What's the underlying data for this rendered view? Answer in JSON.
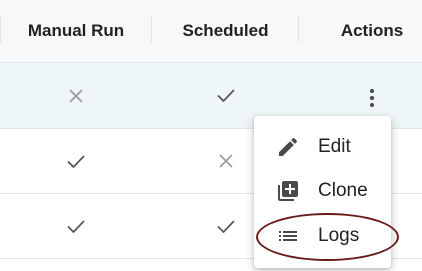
{
  "table": {
    "headers": [
      "Manual Run",
      "Scheduled",
      "Actions"
    ],
    "rows": [
      {
        "manual_run": "cross",
        "scheduled": "check",
        "highlighted": true
      },
      {
        "manual_run": "check",
        "scheduled": "cross",
        "highlighted": false
      },
      {
        "manual_run": "check",
        "scheduled": "check",
        "highlighted": false
      }
    ]
  },
  "actions_menu": {
    "items": [
      {
        "label": "Edit",
        "icon": "pencil-icon"
      },
      {
        "label": "Clone",
        "icon": "library-add-icon"
      },
      {
        "label": "Logs",
        "icon": "list-icon"
      }
    ],
    "annotation": {
      "shape": "ellipse",
      "target": "Logs",
      "color": "#6b1a1a"
    }
  },
  "colors": {
    "header_bg": "#f7f8f9",
    "row_highlight": "#eef6f8",
    "divider": "#e1e4e8",
    "check": "#555555",
    "cross": "#9a9a9a"
  }
}
